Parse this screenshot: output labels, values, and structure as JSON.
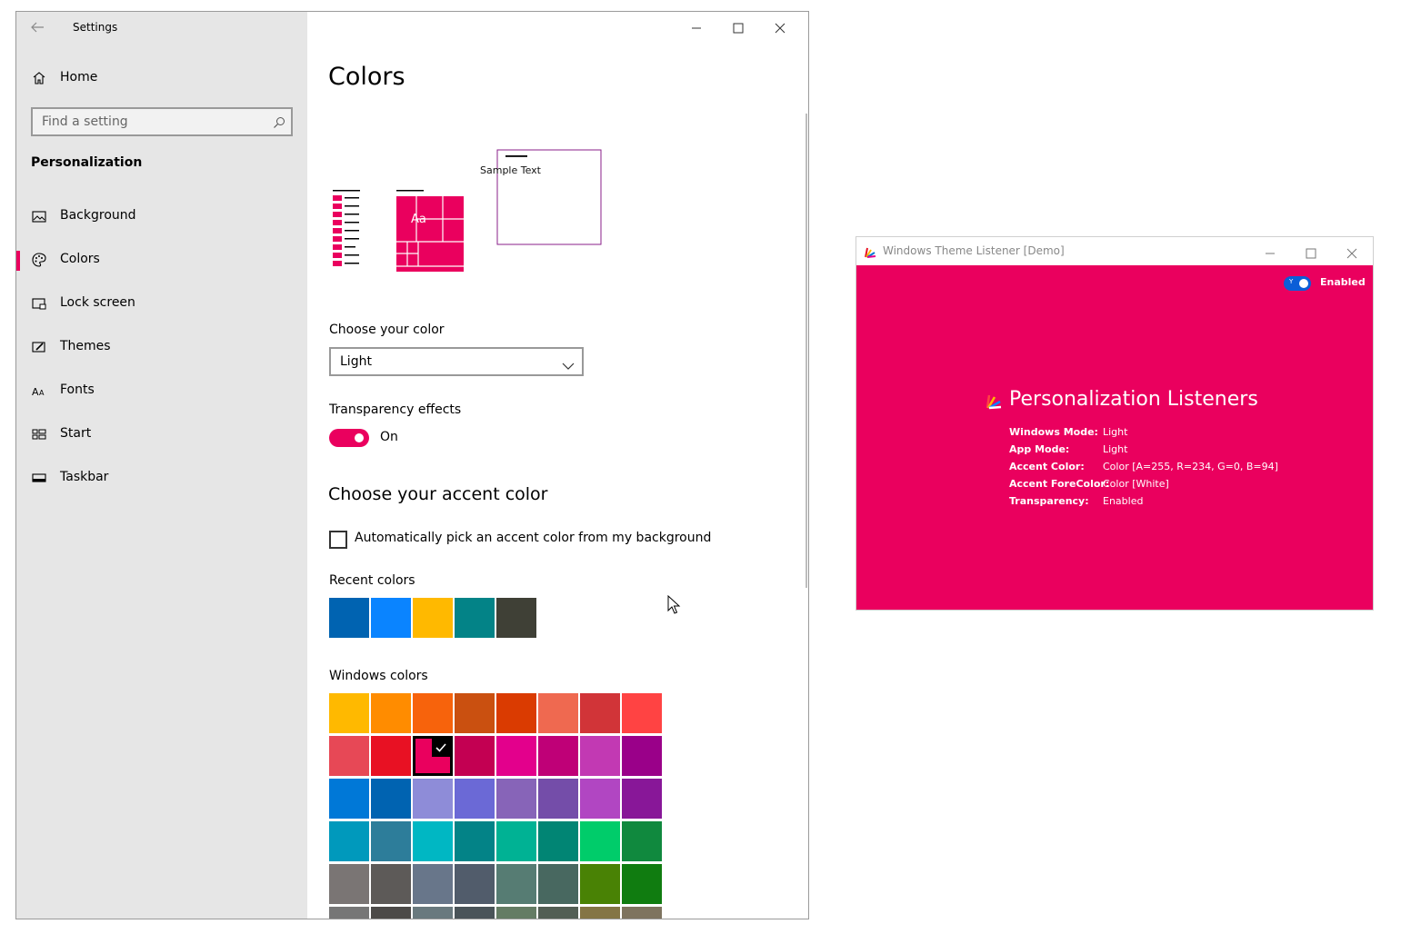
{
  "settings": {
    "title": "Settings",
    "home_label": "Home",
    "search_placeholder": "Find a setting",
    "section": "Personalization",
    "nav_items": [
      {
        "label": "Background",
        "icon": "picture-icon",
        "selected": false
      },
      {
        "label": "Colors",
        "icon": "palette-icon",
        "selected": true
      },
      {
        "label": "Lock screen",
        "icon": "lock-screen-icon",
        "selected": false
      },
      {
        "label": "Themes",
        "icon": "themes-icon",
        "selected": false
      },
      {
        "label": "Fonts",
        "icon": "fonts-icon",
        "selected": false
      },
      {
        "label": "Start",
        "icon": "start-icon",
        "selected": false
      },
      {
        "label": "Taskbar",
        "icon": "taskbar-icon",
        "selected": false
      }
    ],
    "page_title": "Colors",
    "preview_sample_text": "Sample Text",
    "preview_tile_text": "Aa",
    "choose_color_label": "Choose your color",
    "choose_color_value": "Light",
    "transparency_label": "Transparency effects",
    "transparency_state": "On",
    "accent_heading": "Choose your accent color",
    "auto_pick_label": "Automatically pick an accent color from my background",
    "recent_colors_label": "Recent colors",
    "recent_colors": [
      "#0063b1",
      "#0a84ff",
      "#ffb900",
      "#038387",
      "#3f4036"
    ],
    "windows_colors_label": "Windows colors",
    "windows_colors": [
      [
        "#ffb900",
        "#ff8c00",
        "#f7630c",
        "#ca5010",
        "#da3b01",
        "#ef6950",
        "#d13438",
        "#ff4343"
      ],
      [
        "#e74856",
        "#e81123",
        "#ea005e",
        "#c30052",
        "#e3008c",
        "#bf0077",
        "#c239b3",
        "#9a0089"
      ],
      [
        "#0078d7",
        "#0063b1",
        "#8e8cd8",
        "#6b69d6",
        "#8764b8",
        "#744da9",
        "#b146c2",
        "#881798"
      ],
      [
        "#0099bc",
        "#2d7d9a",
        "#00b7c3",
        "#038387",
        "#00b294",
        "#018574",
        "#00cc6a",
        "#10893e"
      ],
      [
        "#7a7574",
        "#5d5a58",
        "#68768a",
        "#515c6b",
        "#567c73",
        "#486860",
        "#498205",
        "#107c10"
      ],
      [
        "#767676",
        "#4c4a48",
        "#69797e",
        "#4a5459",
        "#647c64",
        "#525e54",
        "#847545",
        "#7e735f"
      ]
    ],
    "selected_color_index": [
      1,
      2
    ],
    "accent_color": "#ea005e"
  },
  "demo": {
    "title": "Windows Theme Listener [Demo]",
    "toggle_label": "Enabled",
    "toggle_icon": "Y",
    "heading": "Personalization Listeners",
    "properties": [
      {
        "key": "Windows Mode:",
        "value": "Light"
      },
      {
        "key": "App Mode:",
        "value": "Light"
      },
      {
        "key": "Accent Color:",
        "value": "Color [A=255, R=234, G=0, B=94]"
      },
      {
        "key": "Accent ForeColor:",
        "value": "Color [White]"
      },
      {
        "key": "Transparency:",
        "value": "Enabled"
      }
    ],
    "background_color": "#ea005e"
  }
}
